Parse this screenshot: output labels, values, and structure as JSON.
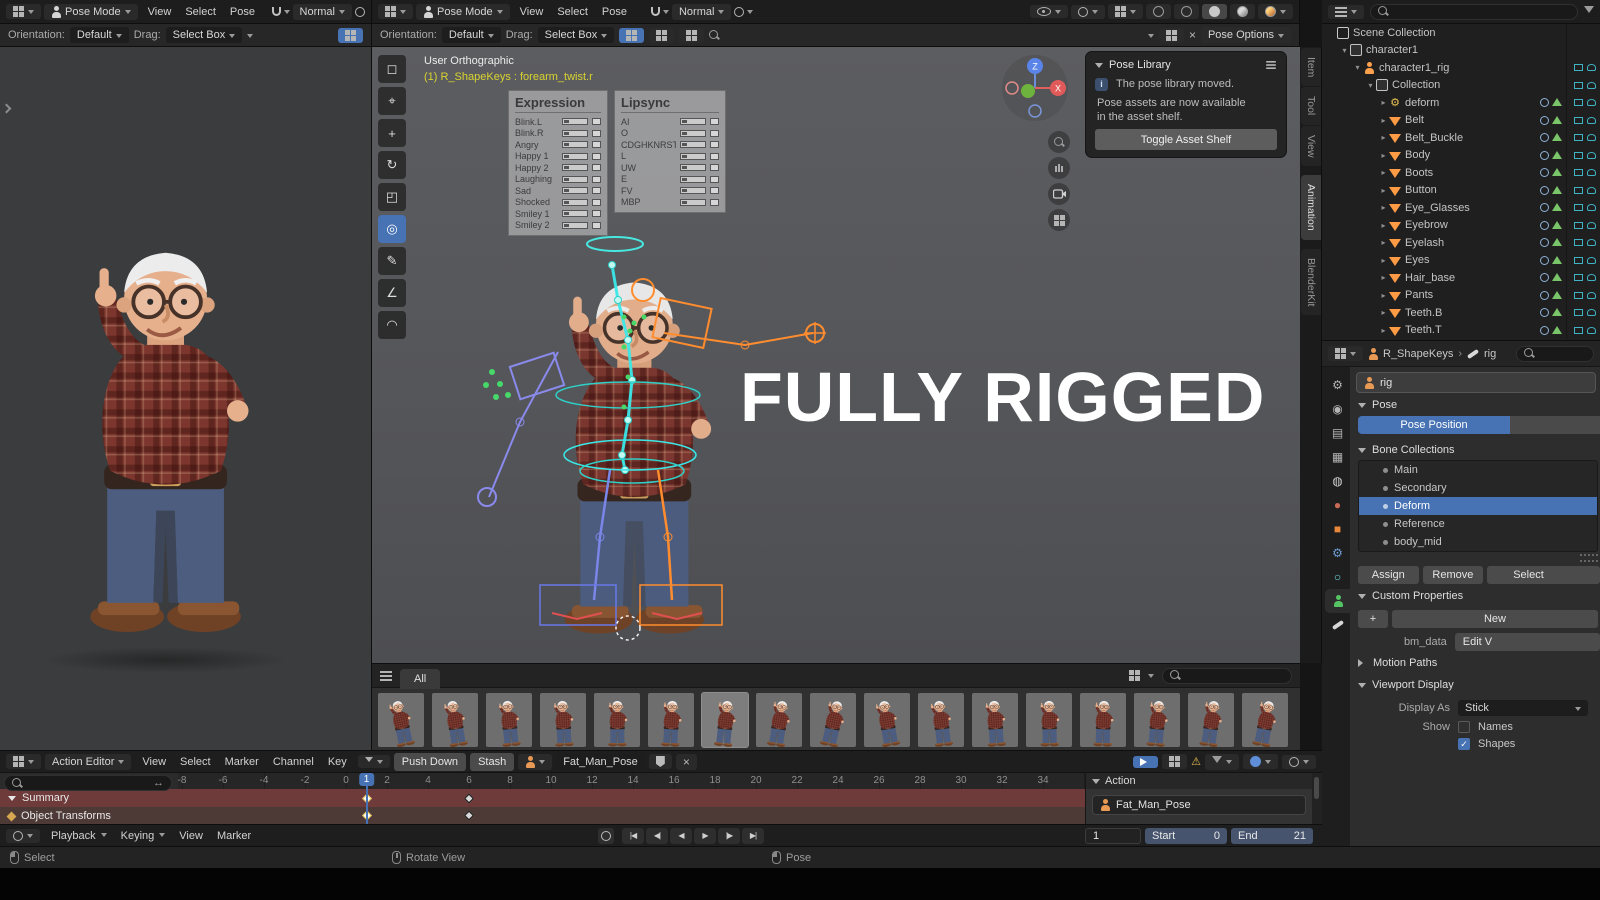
{
  "accent": "#4772b3",
  "icons": {
    "breadcrumb_sep": "›",
    "warning": "⚠",
    "gear": "⚙",
    "double_arrow": "↔",
    "close": "×",
    "check": "✓"
  },
  "toolbar_tools": [
    {
      "name": "select-box",
      "glyph": "◻"
    },
    {
      "name": "cursor",
      "glyph": "⌖"
    },
    {
      "name": "move",
      "glyph": "+"
    },
    {
      "name": "rotate",
      "glyph": "↻"
    },
    {
      "name": "scale",
      "glyph": "◰"
    },
    {
      "name": "transform",
      "glyph": "◎"
    },
    {
      "name": "annotate",
      "glyph": "✎"
    },
    {
      "name": "measure",
      "glyph": "∠"
    },
    {
      "name": "curve",
      "glyph": "◠"
    }
  ],
  "active_tool": "transform",
  "viewportA_header": {
    "mode": "Pose Mode",
    "menus": [
      "View",
      "Select",
      "Pose"
    ],
    "pivot": "Normal",
    "tool_settings": {
      "orientation_label": "Orientation:",
      "orientation": "Default",
      "drag_label": "Drag:",
      "drag": "Select Box"
    }
  },
  "viewportB_header": {
    "mode": "Pose Mode",
    "menus": [
      "View",
      "Select",
      "Pose"
    ],
    "pivot": "Normal",
    "tool_settings": {
      "orientation_label": "Orientation:",
      "orientation": "Default",
      "drag_label": "Drag:",
      "drag": "Select Box",
      "pose_options": "Pose Options"
    }
  },
  "viewport": {
    "view_label": "User Orthographic",
    "active_label": "(1) R_ShapeKeys : forearm_twist.r",
    "watermark": "FULLY RIGGED",
    "gizmo": {
      "z": "Z",
      "x": "X"
    }
  },
  "expression_panel": {
    "title": "Expression",
    "rows": [
      "Blink.L",
      "Blink.R",
      "Angry",
      "Happy 1",
      "Happy 2",
      "Laughing",
      "Sad",
      "Shocked",
      "Smiley 1",
      "Smiley 2"
    ]
  },
  "lipsync_panel": {
    "title": "Lipsync",
    "rows": [
      "AI",
      "O",
      "CDGHKNRST",
      "L",
      "UW",
      "E",
      "FV",
      "MBP"
    ]
  },
  "pose_library": {
    "title": "Pose Library",
    "line1": "The pose library moved.",
    "line2": "Pose assets are now available",
    "line3": "in the asset shelf.",
    "button": "Toggle Asset Shelf"
  },
  "side_tabs": {
    "items": [
      "Item",
      "Tool",
      "View",
      "Animation",
      "BlenderKit"
    ],
    "active": "Animation"
  },
  "outliner": {
    "items": [
      {
        "label": "Scene Collection",
        "depth": 0,
        "icon": "scene",
        "caret": ""
      },
      {
        "label": "character1",
        "depth": 1,
        "icon": "collection",
        "caret": "▾"
      },
      {
        "label": "character1_rig",
        "depth": 2,
        "icon": "armature",
        "caret": "▾"
      },
      {
        "label": "Collection",
        "depth": 3,
        "icon": "collection",
        "caret": "▾"
      },
      {
        "label": "deform",
        "depth": 4,
        "icon": "deform",
        "caret": "▸"
      },
      {
        "label": "Belt",
        "depth": 4,
        "icon": "mesh",
        "caret": "▸"
      },
      {
        "label": "Belt_Buckle",
        "depth": 4,
        "icon": "mesh",
        "caret": "▸"
      },
      {
        "label": "Body",
        "depth": 4,
        "icon": "mesh",
        "caret": "▸"
      },
      {
        "label": "Boots",
        "depth": 4,
        "icon": "mesh",
        "caret": "▸"
      },
      {
        "label": "Button",
        "depth": 4,
        "icon": "mesh",
        "caret": "▸"
      },
      {
        "label": "Eye_Glasses",
        "depth": 4,
        "icon": "mesh",
        "caret": "▸"
      },
      {
        "label": "Eyebrow",
        "depth": 4,
        "icon": "mesh",
        "caret": "▸"
      },
      {
        "label": "Eyelash",
        "depth": 4,
        "icon": "mesh",
        "caret": "▸"
      },
      {
        "label": "Eyes",
        "depth": 4,
        "icon": "mesh",
        "caret": "▸"
      },
      {
        "label": "Hair_base",
        "depth": 4,
        "icon": "mesh",
        "caret": "▸"
      },
      {
        "label": "Pants",
        "depth": 4,
        "icon": "mesh",
        "caret": "▸"
      },
      {
        "label": "Teeth.B",
        "depth": 4,
        "icon": "mesh",
        "caret": "▸"
      },
      {
        "label": "Teeth.T",
        "depth": 4,
        "icon": "mesh",
        "caret": "▸"
      }
    ]
  },
  "properties": {
    "breadcrumb_object": "R_ShapeKeys",
    "breadcrumb_data": "rig",
    "name_value": "rig",
    "sections": {
      "pose": "Pose",
      "bone_collections": "Bone Collections",
      "custom_properties": "Custom Properties",
      "motion_paths": "Motion Paths",
      "viewport_display": "Viewport Display"
    },
    "pose_position": "Pose Position",
    "bone_collections": [
      "Main",
      "Secondary",
      "Deform",
      "Reference",
      "body_mid"
    ],
    "active_collection": "Deform",
    "assign": "Assign",
    "remove": "Remove",
    "select": "Select",
    "new": "New",
    "custom_prop": "bm_data",
    "edit_value": "Edit V",
    "display_as_label": "Display As",
    "display_as": "Stick",
    "show_label": "Show",
    "names": "Names",
    "shapes": "Shapes"
  },
  "asset_shelf": {
    "tab": "All",
    "pose_count": 17
  },
  "dopesheet": {
    "editor": "Action Editor",
    "menus": [
      "View",
      "Select",
      "Marker",
      "Channel",
      "Key"
    ],
    "push_down": "Push Down",
    "stash": "Stash",
    "action_name": "Fat_Man_Pose",
    "channels": [
      "Summary",
      "Object Transforms"
    ],
    "ruler": [
      "-8",
      "-6",
      "-4",
      "-2",
      "0",
      "2",
      "4",
      "6",
      "8",
      "10",
      "12",
      "14",
      "16",
      "18",
      "20",
      "22",
      "24",
      "26",
      "28",
      "30",
      "32",
      "34"
    ],
    "playhead": "1",
    "keyframes": [
      1,
      6
    ],
    "sidebar": {
      "title": "Action",
      "action": "Fat_Man_Pose"
    }
  },
  "timeline": {
    "menus": [
      "Playback",
      "Keying",
      "View",
      "Marker"
    ],
    "transport": [
      "|◀",
      "◀|",
      "◀",
      "▶",
      "|▶",
      "▶|"
    ],
    "frame": "1",
    "start_label": "Start",
    "start": "0",
    "end_label": "End",
    "end": "21"
  },
  "statusbar": {
    "items": [
      "Select",
      "Rotate View",
      "Pose"
    ]
  }
}
